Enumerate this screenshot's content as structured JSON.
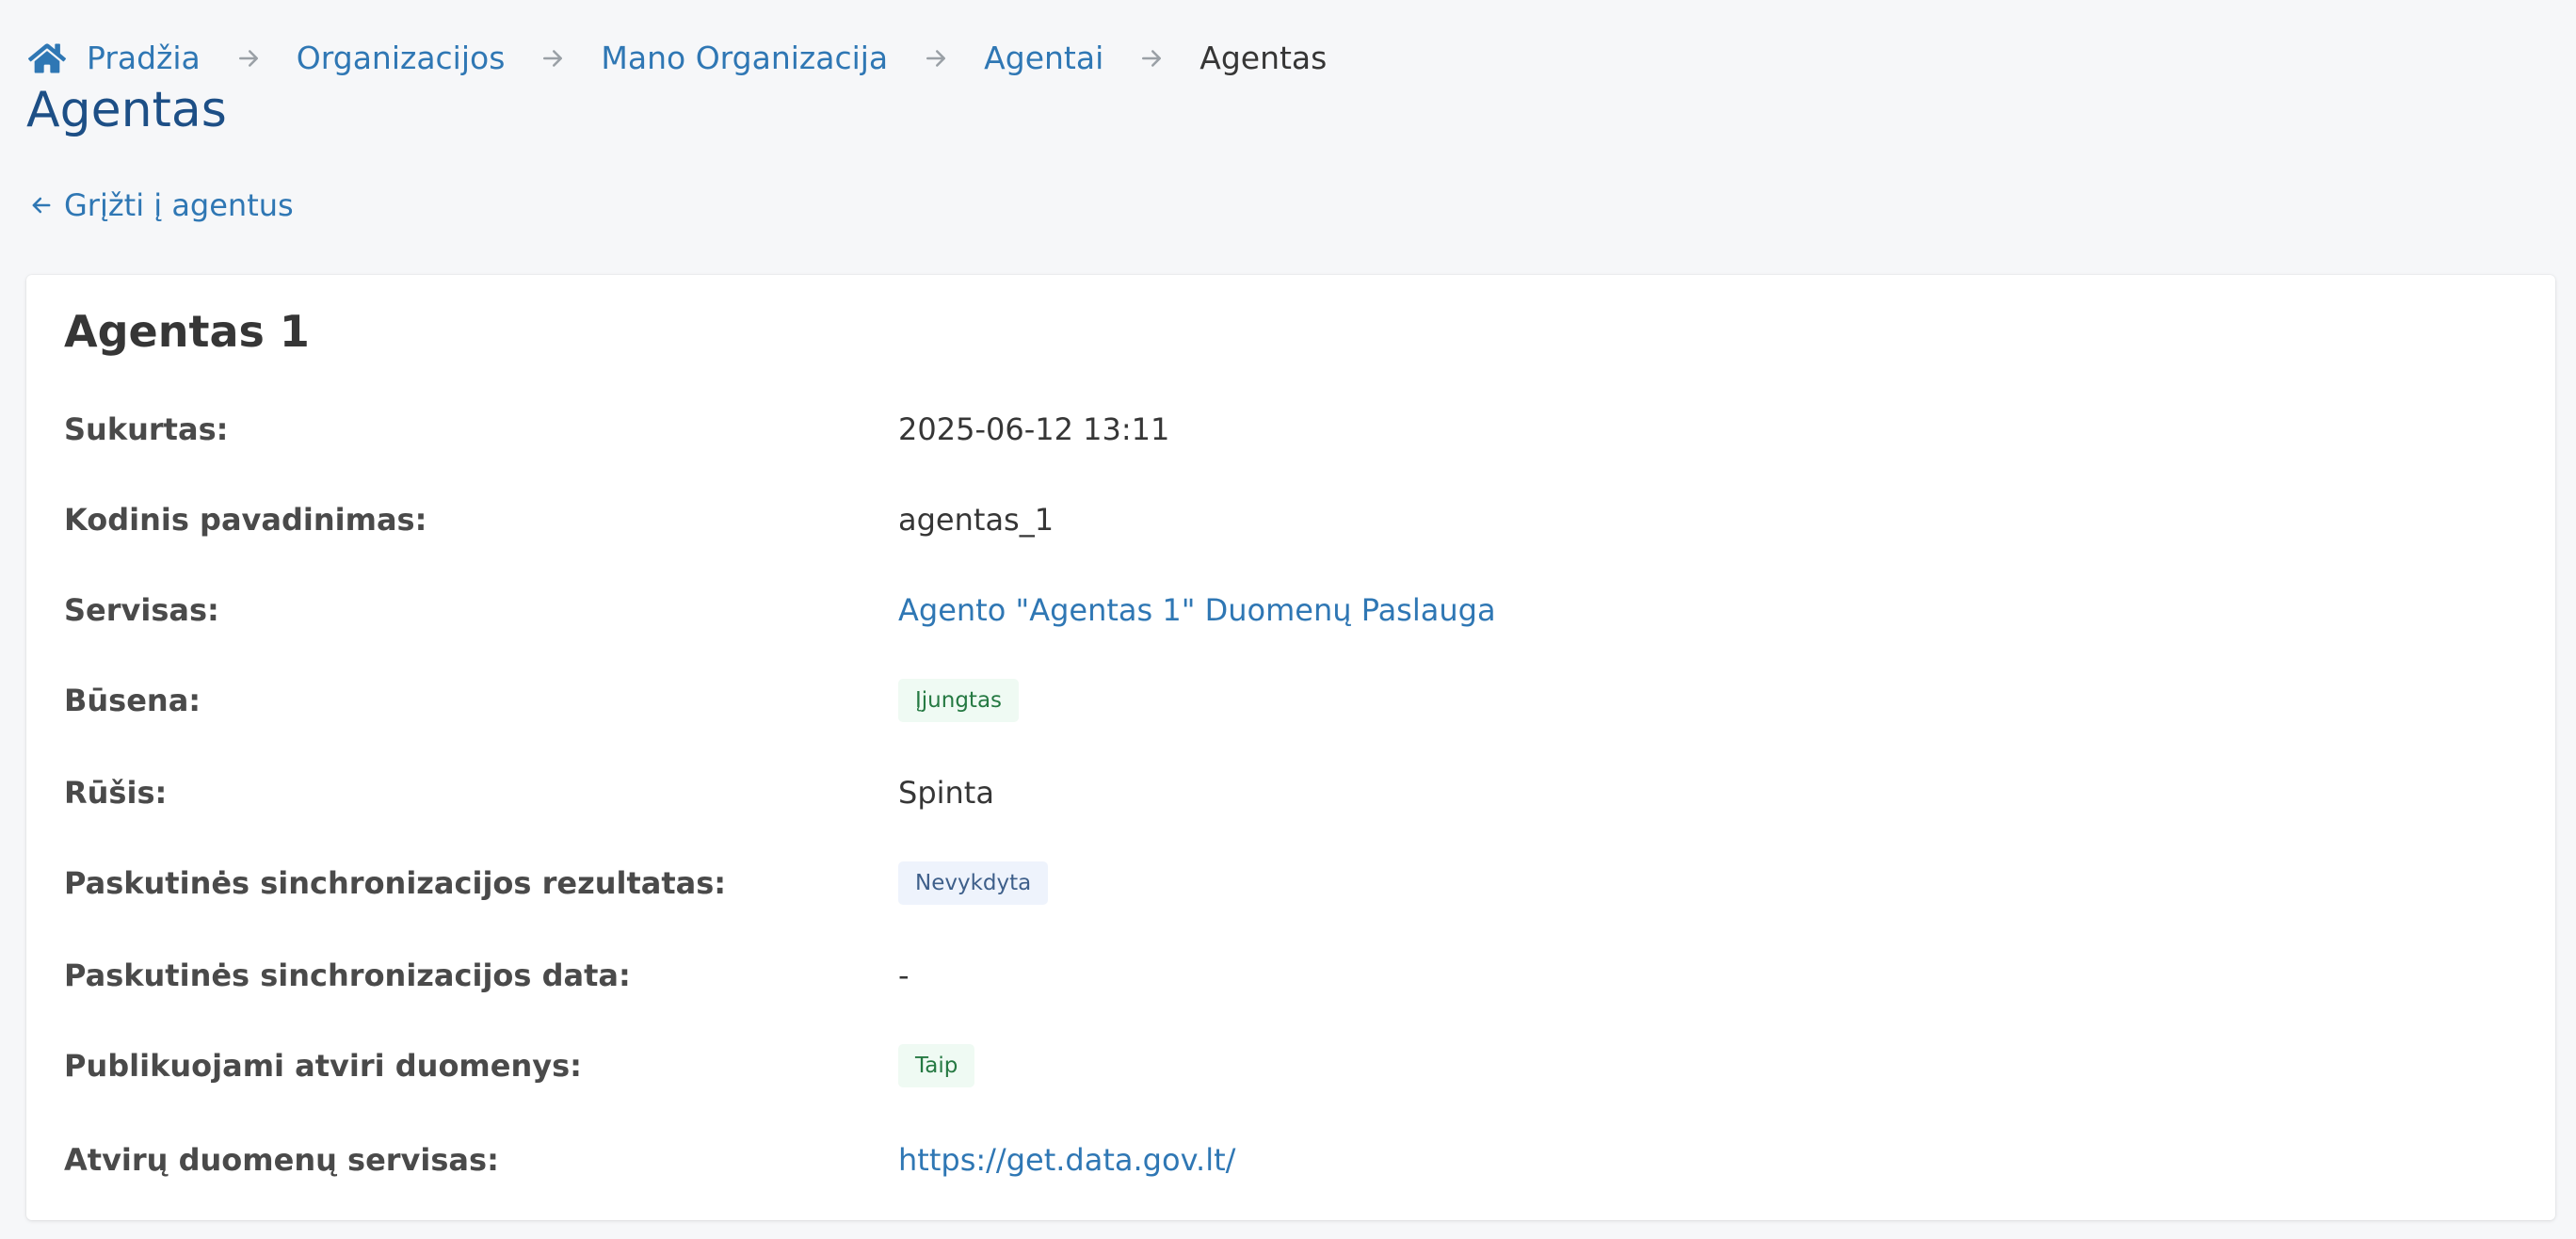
{
  "breadcrumb": {
    "home": "Pradžia",
    "items": [
      "Organizacijos",
      "Mano Organizacija",
      "Agentai"
    ],
    "current": "Agentas"
  },
  "page_title": "Agentas",
  "back_link": "Grįžti į agentus",
  "agent": {
    "name": "Agentas 1",
    "fields": {
      "created": {
        "label": "Sukurtas:",
        "value": "2025-06-12 13:11"
      },
      "code_name": {
        "label": "Kodinis pavadinimas:",
        "value": "agentas_1"
      },
      "service": {
        "label": "Servisas:",
        "value": "Agento \"Agentas 1\" Duomenų Paslauga"
      },
      "status": {
        "label": "Būsena:",
        "value": "Įjungtas"
      },
      "type": {
        "label": "Rūšis:",
        "value": "Spinta"
      },
      "last_sync_result": {
        "label": "Paskutinės sinchronizacijos rezultatas:",
        "value": "Nevykdyta"
      },
      "last_sync_date": {
        "label": "Paskutinės sinchronizacijos data:",
        "value": "-"
      },
      "publishes_open_data": {
        "label": "Publikuojami atviri duomenys:",
        "value": "Taip"
      },
      "open_data_service": {
        "label": "Atvirų duomenų servisas:",
        "value": "https://get.data.gov.lt/"
      }
    }
  },
  "icons": {
    "home": "home-icon",
    "separator": "arrow-right-icon",
    "back": "arrow-left-icon"
  },
  "colors": {
    "link": "#2f77b4",
    "title": "#1d4f86",
    "tag_success_bg": "#effaf3",
    "tag_success_text": "#257942",
    "tag_info_bg": "#eef3fc",
    "tag_info_text": "#3e5f8a"
  }
}
